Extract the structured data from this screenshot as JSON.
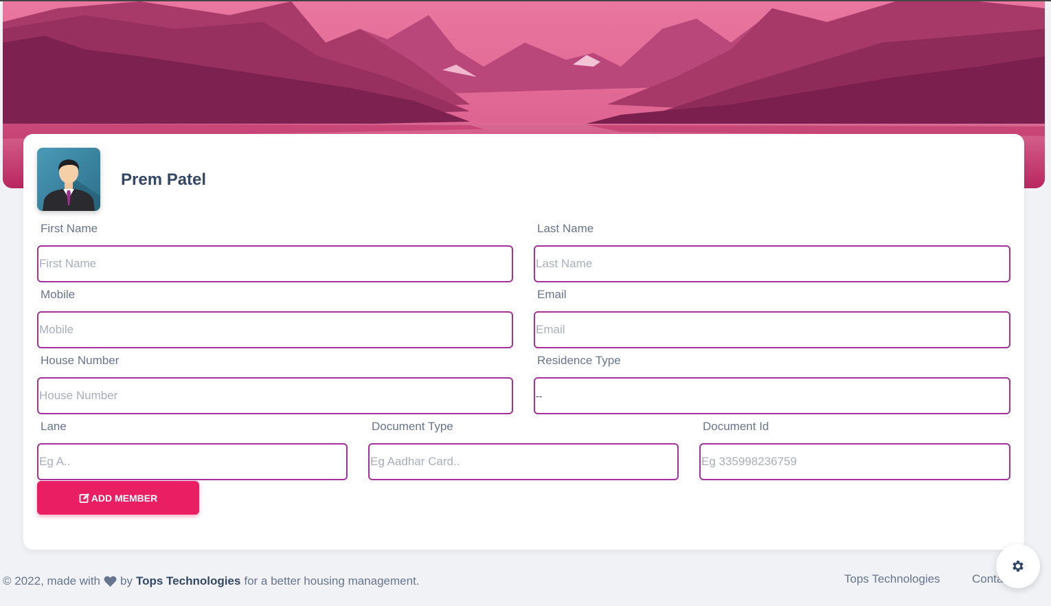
{
  "profile": {
    "name": "Prem Patel"
  },
  "form": {
    "first_name": {
      "label": "First Name",
      "placeholder": "First Name"
    },
    "last_name": {
      "label": "Last Name",
      "placeholder": "Last Name"
    },
    "mobile": {
      "label": "Mobile",
      "placeholder": "Mobile"
    },
    "email": {
      "label": "Email",
      "placeholder": "Email"
    },
    "house_number": {
      "label": "House Number",
      "placeholder": "House Number"
    },
    "residence_type": {
      "label": "Residence Type",
      "selected": "--"
    },
    "lane": {
      "label": "Lane",
      "placeholder": "Eg A.."
    },
    "document_type": {
      "label": "Document Type",
      "placeholder": "Eg Aadhar Card.."
    },
    "document_id": {
      "label": "Document Id",
      "placeholder": "Eg 335998236759"
    },
    "submit_label": "ADD MEMBER",
    "submit_icon": "edit-icon"
  },
  "footer": {
    "copyright_prefix": "© 2022, made with",
    "heart_icon": "heart-icon",
    "by": "by",
    "company": "Tops Technologies",
    "suffix": "for a better housing management.",
    "links": [
      "Tops Technologies",
      "Conta"
    ]
  },
  "settings": {
    "icon": "gear-icon"
  },
  "colors": {
    "accent": "#e91e63",
    "input_border": "#a3309b",
    "banner_tint": "#d24b7f",
    "text_dark": "#344767",
    "text_muted": "#67748e",
    "background": "#f0f2f5"
  }
}
